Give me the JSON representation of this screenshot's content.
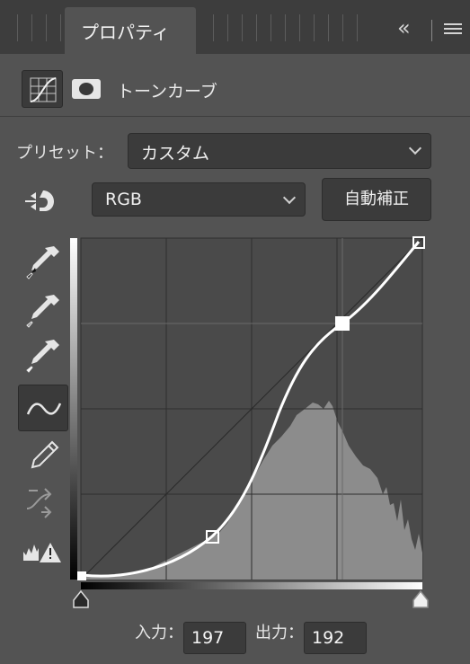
{
  "tabs": {
    "active_label": "プロパティ"
  },
  "header": {
    "adjustment_type_icon": "curves-adjustment-icon",
    "mask_icon": "layer-mask-icon",
    "title": "トーンカーブ"
  },
  "preset": {
    "label": "プリセット：",
    "value": "カスタム"
  },
  "channel": {
    "value": "RGB"
  },
  "auto_button": {
    "label": "自動補正"
  },
  "tools": [
    {
      "name": "black-point-eyedropper-icon"
    },
    {
      "name": "gray-point-eyedropper-icon"
    },
    {
      "name": "white-point-eyedropper-icon"
    },
    {
      "name": "curve-points-tool-icon",
      "active": true
    },
    {
      "name": "pencil-draw-icon"
    },
    {
      "name": "smooth-curve-icon"
    },
    {
      "name": "clipping-warning-icon"
    }
  ],
  "curve": {
    "input_label": "入力：",
    "input_value": "197",
    "output_label": "出力：",
    "output_value": "192"
  },
  "colors": {
    "panel_bg": "#535353",
    "graph_bg": "#4a4a4a",
    "histogram": "#8c8c8c",
    "curve": "#ffffff"
  }
}
